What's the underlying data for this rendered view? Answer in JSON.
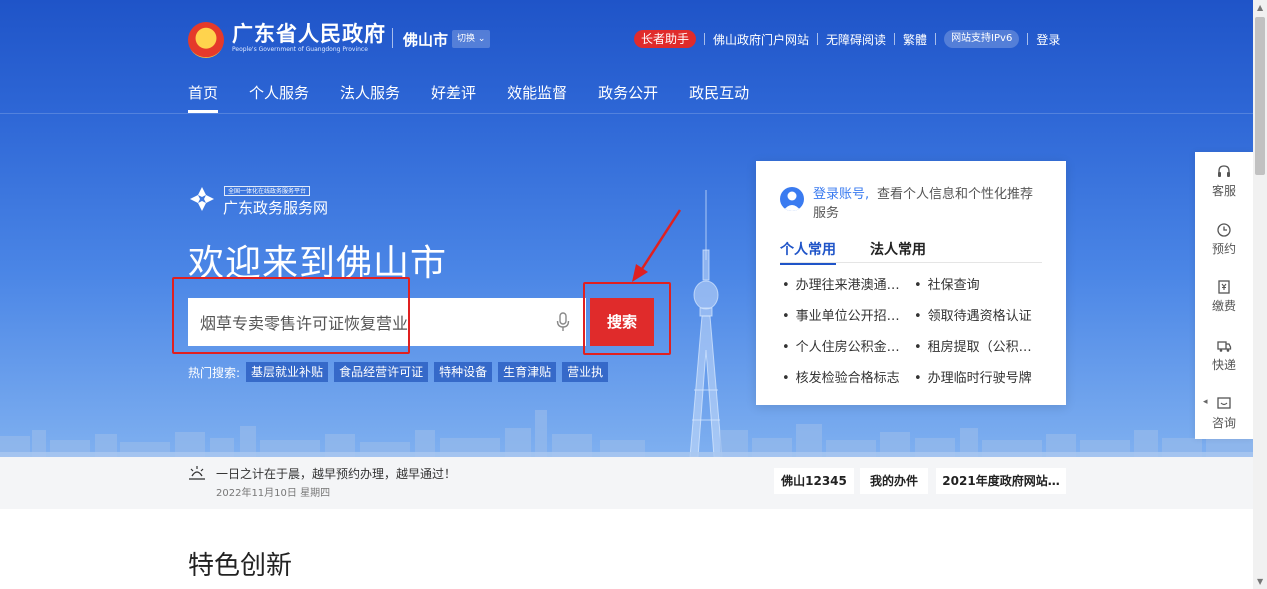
{
  "header": {
    "site_name": "广东省人民政府",
    "site_name_en": "People's Government of Guangdong Province",
    "city": "佛山市",
    "city_switch": "切换",
    "top_links": {
      "elder_helper": "长者助手",
      "portal": "佛山政府门户网站",
      "accessibility": "无障碍阅读",
      "traditional": "繁體",
      "ipv6": "网站支持IPv6",
      "login": "登录"
    },
    "nav": [
      "首页",
      "个人服务",
      "法人服务",
      "好差评",
      "效能监督",
      "政务公开",
      "政民互动"
    ]
  },
  "hero": {
    "platform_small": "全国一体化在线政务服务平台",
    "platform_name": "广东政务服务网",
    "welcome": "欢迎来到佛山市",
    "search": {
      "value": "烟草专卖零售许可证恢复营业",
      "button": "搜索"
    },
    "hot_label": "热门搜索:",
    "hot_tags": [
      "基层就业补贴",
      "食品经营许可证",
      "特种设备",
      "生育津贴",
      "营业执"
    ]
  },
  "card": {
    "login_link": "登录账号,",
    "login_desc": "查看个人信息和个性化推荐",
    "login_desc2": "服务",
    "tabs": [
      "个人常用",
      "法人常用"
    ],
    "items": [
      "办理往来港澳通…",
      "社保查询",
      "事业单位公开招…",
      "领取待遇资格认证",
      "个人住房公积金…",
      "租房提取（公积…",
      "核发检验合格标志",
      "办理临时行驶号牌"
    ]
  },
  "side_toolbar": [
    {
      "label": "客服",
      "icon": "headset-icon"
    },
    {
      "label": "预约",
      "icon": "clock-icon"
    },
    {
      "label": "缴费",
      "icon": "payment-icon"
    },
    {
      "label": "快递",
      "icon": "truck-icon"
    },
    {
      "label": "咨询",
      "icon": "chat-icon"
    }
  ],
  "info_strip": {
    "slogan": "一日之计在于晨，越早预约办理，越早通过！",
    "date": "2022年11月10日 星期四",
    "buttons": [
      "佛山12345",
      "我的办件",
      "2021年度政府网站…"
    ]
  },
  "section": {
    "title": "特色创新"
  },
  "colors": {
    "primary_blue": "#1f54c8",
    "accent_red": "#e02b2b",
    "link_blue": "#3a7bf0"
  }
}
